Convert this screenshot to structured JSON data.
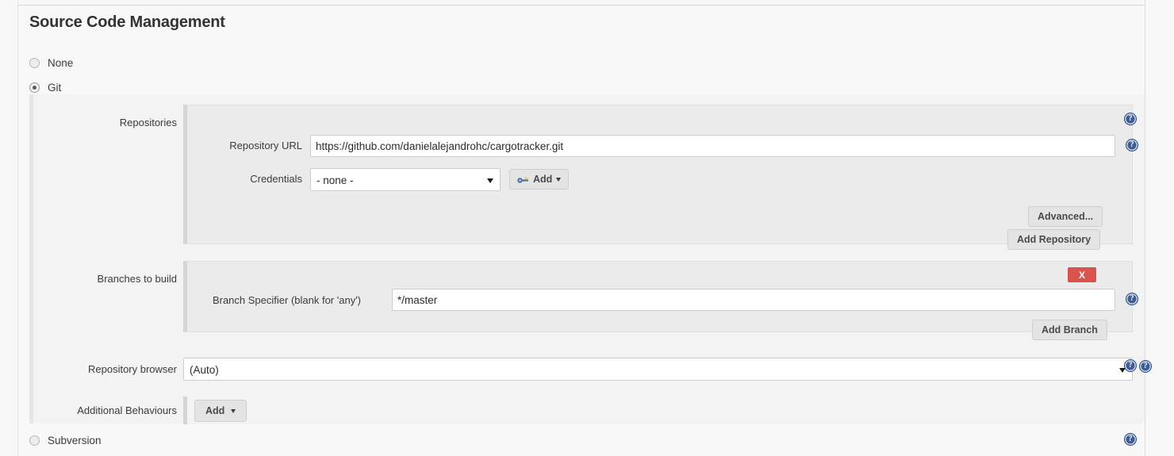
{
  "section": {
    "title": "Source Code Management"
  },
  "scm_options": [
    {
      "label": "None",
      "selected": false
    },
    {
      "label": "Git",
      "selected": true
    },
    {
      "label": "Subversion",
      "selected": false
    }
  ],
  "git": {
    "repositories": {
      "row_label": "Repositories",
      "repository_url": {
        "label": "Repository URL",
        "value": "https://github.com/danielalejandrohc/cargotracker.git",
        "placeholder": ""
      },
      "credentials": {
        "label": "Credentials",
        "selected": "- none -",
        "options": [
          "- none -"
        ],
        "add_button": {
          "label": "Add",
          "icon": "key-icon",
          "caret": "chevron-down-icon"
        }
      },
      "advanced_button": "Advanced...",
      "add_repository_button": "Add Repository"
    },
    "branches": {
      "row_label": "Branches to build",
      "branch_specifier": {
        "label": "Branch Specifier (blank for 'any')",
        "value": "*/master",
        "placeholder": ""
      },
      "delete_button": "X",
      "add_branch_button": "Add Branch"
    },
    "repository_browser": {
      "row_label": "Repository browser",
      "selected": "(Auto)",
      "options": [
        "(Auto)"
      ]
    },
    "additional_behaviours": {
      "row_label": "Additional Behaviours",
      "add_button": "Add"
    }
  },
  "help_icon_glyph": "?",
  "colors": {
    "danger": "#d9534f",
    "help_icon": "#3b5c94",
    "panel_bg": "#ebebeb",
    "body_bg": "#f3f3f3"
  }
}
